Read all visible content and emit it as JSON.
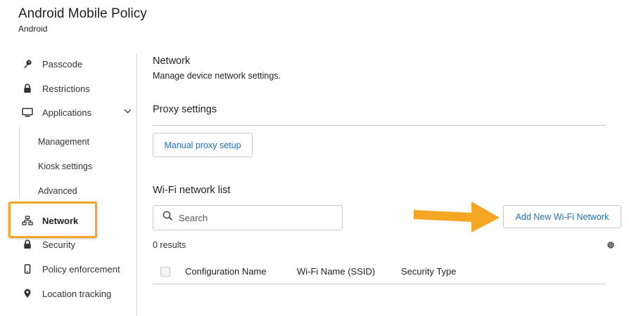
{
  "header": {
    "title": "Android Mobile Policy",
    "subtitle": "Android"
  },
  "sidebar": {
    "items": [
      {
        "label": "Passcode",
        "icon": "key-icon"
      },
      {
        "label": "Restrictions",
        "icon": "lock-icon"
      },
      {
        "label": "Applications",
        "icon": "monitor-icon"
      }
    ],
    "sub_items": [
      "Management",
      "Kiosk settings",
      "Advanced"
    ],
    "items_after": [
      {
        "label": "Network",
        "icon": "network-icon",
        "active": true
      },
      {
        "label": "Security",
        "icon": "lock-icon"
      },
      {
        "label": "Policy enforcement",
        "icon": "phone-icon"
      },
      {
        "label": "Location tracking",
        "icon": "map-pin-icon"
      }
    ]
  },
  "main": {
    "title": "Network",
    "description": "Manage device network settings.",
    "proxy": {
      "heading": "Proxy settings",
      "button_label": "Manual proxy setup"
    },
    "wifi": {
      "heading": "Wi-Fi network list",
      "search_placeholder": "Search",
      "add_button_label": "Add New Wi-Fi Network",
      "results_text": "0 results",
      "columns": [
        "Configuration Name",
        "Wi-Fi Name (SSID)",
        "Security Type"
      ]
    }
  },
  "colors": {
    "accent": "#1e6eb8",
    "highlight": "#f5a623"
  }
}
